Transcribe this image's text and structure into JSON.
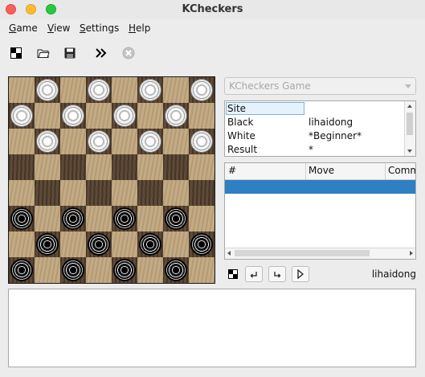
{
  "window": {
    "title": "KCheckers"
  },
  "menu": {
    "game": {
      "u": "G",
      "rest": "ame"
    },
    "view": {
      "u": "V",
      "rest": "iew"
    },
    "settings": {
      "u": "S",
      "rest": "ettings"
    },
    "help": {
      "u": "H",
      "rest": "elp"
    }
  },
  "toolbar": {
    "icons": [
      "new-game-icon",
      "open-icon",
      "save-icon",
      "continue-icon",
      "stop-icon"
    ]
  },
  "board": {
    "pieces": [
      [
        "",
        "w",
        "",
        "w",
        "",
        "w",
        "",
        "w"
      ],
      [
        "w",
        "",
        "w",
        "",
        "w",
        "",
        "w",
        ""
      ],
      [
        "",
        "w",
        "",
        "w",
        "",
        "w",
        "",
        "w"
      ],
      [
        "",
        "",
        "",
        "",
        "",
        "",
        "",
        ""
      ],
      [
        "",
        "",
        "",
        "",
        "",
        "",
        "",
        ""
      ],
      [
        "b",
        "",
        "b",
        "",
        "b",
        "",
        "b",
        ""
      ],
      [
        "",
        "b",
        "",
        "b",
        "",
        "b",
        "",
        "b"
      ],
      [
        "b",
        "",
        "b",
        "",
        "b",
        "",
        "b",
        ""
      ]
    ]
  },
  "game_combo": {
    "placeholder": "KCheckers Game"
  },
  "info": [
    {
      "key": "Site",
      "value": ""
    },
    {
      "key": "Black",
      "value": "lihaidong"
    },
    {
      "key": "White",
      "value": "*Beginner*"
    },
    {
      "key": "Result",
      "value": "*"
    }
  ],
  "moves": {
    "headers": [
      "#",
      "Move",
      "Comm"
    ]
  },
  "current_player": "lihaidong",
  "colors": {
    "selection": "#2f7fc3",
    "accent_border": "#7eb4dc"
  }
}
